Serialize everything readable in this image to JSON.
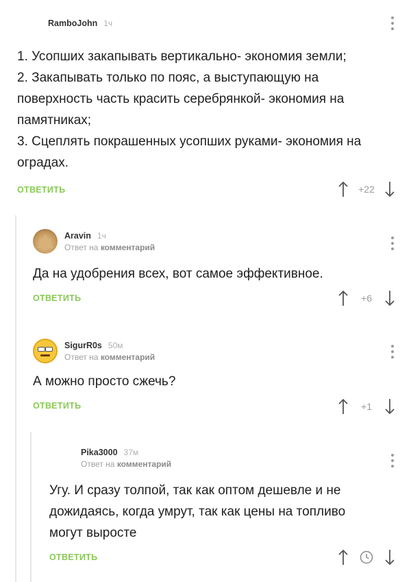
{
  "comments": [
    {
      "author": "RamboJohn",
      "time": "1ч",
      "text": "1. Усопших закапывать вертикально- экономия земли;\n2. Закапывать только по пояс, а выступающую на поверхность часть красить серебрянкой- экономия на памятниках;\n3. Сцеплять покрашенных усопших руками- экономия на оградах.",
      "reply_label": "ОТВЕТИТЬ",
      "rating": "+22"
    },
    {
      "author": "Aravin",
      "time": "1ч",
      "reply_prefix": "Ответ на",
      "reply_target": "комментарий",
      "text": "Да на удобрения всех, вот самое эффективное.",
      "reply_label": "ОТВЕТИТЬ",
      "rating": "+6"
    },
    {
      "author": "SigurR0s",
      "time": "50м",
      "reply_prefix": "Ответ на",
      "reply_target": "комментарий",
      "text": "А можно просто сжечь?",
      "reply_label": "ОТВЕТИТЬ",
      "rating": "+1"
    },
    {
      "author": "Pika3000",
      "time": "37м",
      "reply_prefix": "Ответ на",
      "reply_target": "комментарий",
      "text": "Угу. И сразу толпой, так как оптом дешевле и не дожидаясь, когда умрут, так как цены на топливо могут выросте",
      "reply_label": "ОТВЕТИТЬ",
      "rating_icon": "clock-icon"
    }
  ],
  "colors": {
    "reply_green": "#8ac858",
    "muted_gray": "#9b9b9b",
    "thread_line": "#e6e6e6"
  },
  "icons": {
    "upvote": "arrow-up-icon",
    "downvote": "arrow-down-icon",
    "menu": "more-vertical-icon",
    "pending_rating": "clock-icon"
  }
}
